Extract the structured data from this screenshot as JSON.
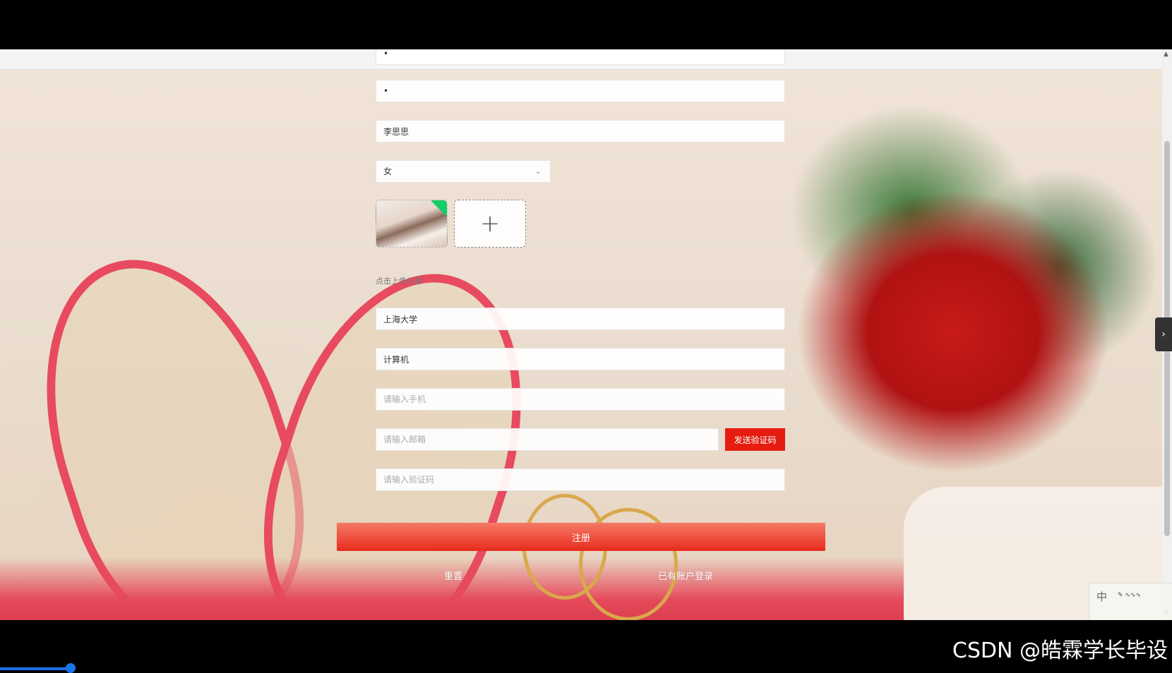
{
  "form": {
    "password_value": "•",
    "confirm_password_value": "•",
    "name_value": "李思思",
    "gender": {
      "selected": "女"
    },
    "upload_hint": "点击上传头像",
    "school_value": "上海大学",
    "major_value": "计算机",
    "phone_placeholder": "请输入手机",
    "email_placeholder": "请输入邮箱",
    "send_code_label": "发送验证码",
    "code_placeholder": "请输入验证码",
    "register_label": "注册",
    "reset_label": "重置",
    "login_link_label": "已有账户登录"
  },
  "icons": {
    "upload": "+",
    "chevron_down": "⌄",
    "side_tab": "›",
    "scroll_up": "▲",
    "scroll_down": "▼"
  },
  "ime": {
    "mode": "中"
  },
  "watermark": "CSDN @皓霖学长毕设",
  "colors": {
    "send_button": "#e51c0f",
    "register_button": "#ef4a3a",
    "avatar_badge": "#13ce66"
  },
  "video_progress": 0.06
}
